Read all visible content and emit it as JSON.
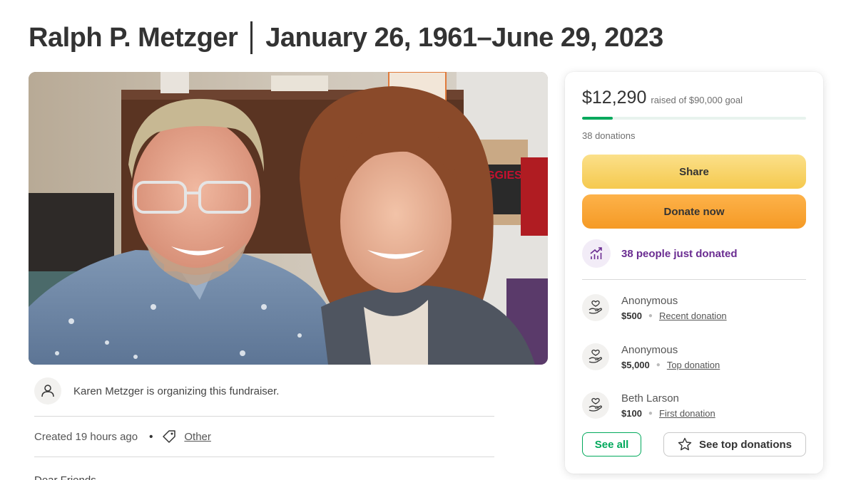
{
  "title": {
    "name": "Ralph P. Metzger",
    "dates": "January 26, 1961–June 29, 2023"
  },
  "photo": {
    "description_icon": "memorial-photo",
    "brand_text": "HUGGIES"
  },
  "organizer": {
    "text": "Karen Metzger is organizing this fundraiser."
  },
  "meta": {
    "created": "Created 19 hours ago",
    "dot": "•",
    "category": "Other"
  },
  "story": {
    "preview": "Dear Friends,"
  },
  "donation_card": {
    "raised": "$12,290",
    "goal_text": "raised of $90,000 goal",
    "progress_fraction": 0.1366,
    "donations_count": "38 donations",
    "share_label": "Share",
    "donate_label": "Donate now",
    "just_donated": "38 people just donated",
    "donors": [
      {
        "name": "Anonymous",
        "amount": "$500",
        "type": "Recent donation"
      },
      {
        "name": "Anonymous",
        "amount": "$5,000",
        "type": "Top donation"
      },
      {
        "name": "Beth Larson",
        "amount": "$100",
        "type": "First donation"
      }
    ],
    "see_all_label": "See all",
    "top_donations_label": "See top donations"
  },
  "colors": {
    "accent_green": "#02a95c",
    "share_yellow": "#f5c94e",
    "donate_orange": "#f59a25",
    "purple": "#6a2c91"
  }
}
